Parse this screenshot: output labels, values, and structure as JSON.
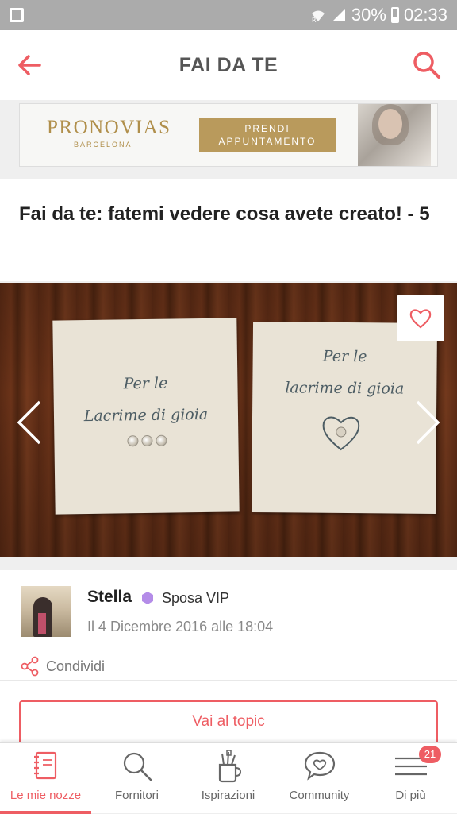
{
  "status_bar": {
    "battery_text": "30%",
    "time": "02:33"
  },
  "header": {
    "title": "FAI DA TE",
    "back_icon": "arrow-left-icon",
    "search_icon": "search-icon",
    "accent_color": "#ee5d63"
  },
  "ad": {
    "brand": "PRONOVIAS",
    "city": "BARCELONA",
    "cta_line1": "PRENDI",
    "cta_line2": "APPUNTAMENTO"
  },
  "post": {
    "title": "Fai da te: fatemi vedere cosa avete creato! - 5",
    "card_left": {
      "line1": "Per le",
      "line2": "Lacrime di gioia"
    },
    "card_right": {
      "line1": "Per le",
      "line2": "lacrime di gioia"
    }
  },
  "author": {
    "name": "Stella",
    "badge": "Sposa VIP",
    "date": "Il 4 Dicembre 2016 alle 18:04",
    "share_label": "Condividi"
  },
  "cta": {
    "label": "Vai al topic"
  },
  "bottom_nav": {
    "items": [
      {
        "label": "Le mie nozze",
        "icon": "notebook-icon",
        "active": true
      },
      {
        "label": "Fornitori",
        "icon": "search-icon",
        "active": false
      },
      {
        "label": "Ispirazioni",
        "icon": "brush-cup-icon",
        "active": false
      },
      {
        "label": "Community",
        "icon": "chat-heart-icon",
        "active": false
      },
      {
        "label": "Di più",
        "icon": "menu-icon",
        "active": false,
        "badge": "21"
      }
    ]
  }
}
